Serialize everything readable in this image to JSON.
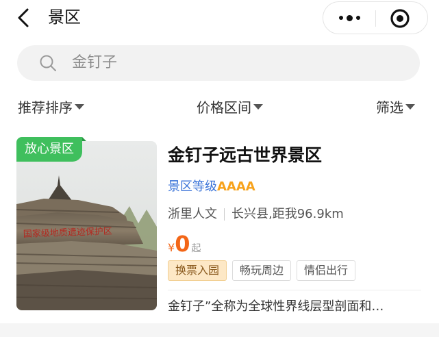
{
  "header": {
    "title": "景区"
  },
  "search": {
    "query": "金钉子"
  },
  "filters": {
    "sort_label": "推荐排序",
    "price_label": "价格区间",
    "filter_label": "筛选"
  },
  "listing": {
    "badge": "放心景区",
    "name": "金钉子远古世界景区",
    "level_label": "景区等级",
    "level_value": "AAAA",
    "category": "浙里人文",
    "location": "长兴县,距我96.9km",
    "price_currency": "¥",
    "price_value": "0",
    "price_suffix": "起",
    "tags": [
      "换票入园",
      "畅玩周边",
      "情侣出行"
    ],
    "description": "金钉子”全称为全球性界线层型剖面和…",
    "image_sign_text": "国家级地质遗迹保护区"
  },
  "colors": {
    "accent_blue": "#3a73d8",
    "rating_orange": "#f7a21b",
    "price_orange": "#f36617",
    "badge_green": "#3fbf5d"
  },
  "icons": {
    "back": "chevron-left-icon",
    "more": "more-dots-icon",
    "close": "target-close-icon",
    "search": "search-icon",
    "dropdown": "caret-down-icon"
  }
}
